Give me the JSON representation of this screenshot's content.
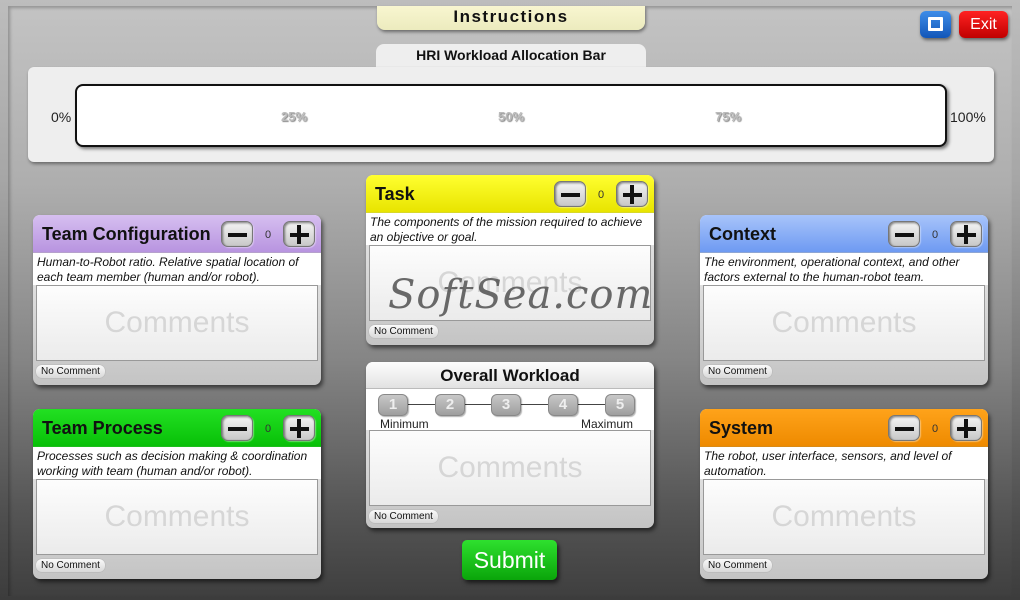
{
  "window": {
    "instructions_label": "Instructions",
    "maximize_icon": "maximize-icon",
    "exit_label": "Exit"
  },
  "allocation": {
    "title": "HRI Workload Allocation Bar",
    "min_label": "0%",
    "max_label": "100%",
    "ticks": [
      "25%",
      "50%",
      "75%"
    ]
  },
  "cards": {
    "team_config": {
      "title": "Team Configuration",
      "color": "#c5a8e6",
      "value": "0",
      "description": "Human-to-Robot ratio. Relative spatial location of each team member (human and/or robot).",
      "comment_placeholder": "Comments",
      "no_comment_label": "No Comment"
    },
    "task": {
      "title": "Task",
      "color": "#f4f000",
      "value": "0",
      "description": "The components of the mission required to achieve an objective or goal.",
      "comment_placeholder": "Comments",
      "no_comment_label": "No Comment"
    },
    "context": {
      "title": "Context",
      "color": "#7ea7f5",
      "value": "0",
      "description": "The environment, operational context, and other factors external to the human-robot team.",
      "comment_placeholder": "Comments",
      "no_comment_label": "No Comment"
    },
    "team_process": {
      "title": "Team Process",
      "color": "#11cc11",
      "value": "0",
      "description": "Processes such as decision making & coordination working with team (human and/or robot).",
      "comment_placeholder": "Comments",
      "no_comment_label": "No Comment"
    },
    "system": {
      "title": "System",
      "color": "#f59400",
      "value": "0",
      "description": "The robot, user interface, sensors, and level of automation.",
      "comment_placeholder": "Comments",
      "no_comment_label": "No Comment"
    }
  },
  "overall": {
    "title": "Overall Workload",
    "scale": [
      "1",
      "2",
      "3",
      "4",
      "5"
    ],
    "min_label": "Minimum",
    "max_label": "Maximum",
    "comment_placeholder": "Comments",
    "no_comment_label": "No Comment"
  },
  "submit_label": "Submit",
  "watermark": "SoftSea.com"
}
